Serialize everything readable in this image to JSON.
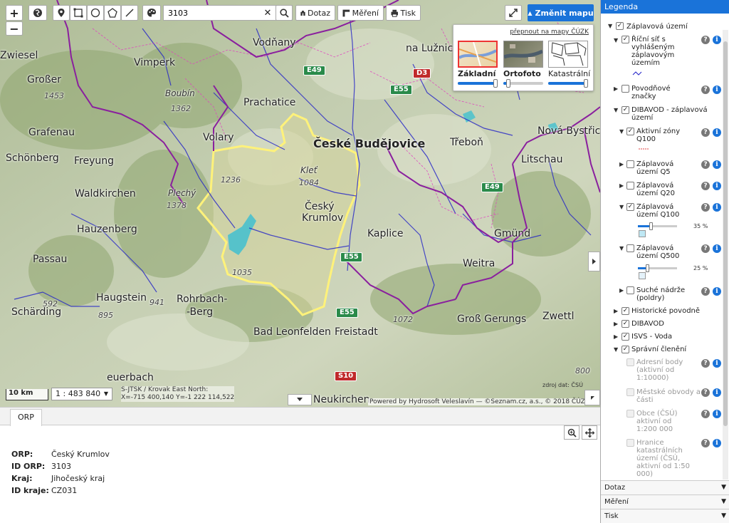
{
  "toolbar": {
    "search_value": "3103",
    "dotaz_label": "Dotaz",
    "mereni_label": "Měření",
    "tisk_label": "Tisk",
    "zmenit_label": "Změnit mapu"
  },
  "map_switch": {
    "link": "přepnout na mapy ČÚZK",
    "options": [
      {
        "label": "Základní",
        "opacity": 1.0,
        "selected": true
      },
      {
        "label": "Ortofoto",
        "opacity": 0.12,
        "selected": false
      },
      {
        "label": "Katastrální",
        "opacity": 1.0,
        "selected": false
      }
    ]
  },
  "map": {
    "labels": {
      "zwiesel": "Zwiesel",
      "grosser_arber": "Großer\nArber",
      "vimperk": "Vimperk",
      "vodnany": "Vodňany",
      "nahory": "na Lužnicí",
      "boubin": "Boubín",
      "prachatice": "Prachatice",
      "volary": "Volary",
      "grafenau": "Grafenau",
      "ceske_budejovice": "České Budějovice",
      "trebon": "Třeboň",
      "nove_bystrice": "Nová Bystřice",
      "schonberg": "Schönberg",
      "freyung": "Freyung",
      "klet": "Kleť",
      "cesky_krumlov": "Český\nKrumlov",
      "litschau": "Litschau",
      "waldkirchen": "Waldkirchen",
      "plechy": "Plechý",
      "hauzenberg": "Hauzenberg",
      "kaplice": "Kaplice",
      "gmund": "Gmünd",
      "passau": "Passau",
      "weitra": "Weitra",
      "haugstein": "Haugstein",
      "rohrbach": "Rohrbach-\n-Berg",
      "scharding": "Schärding",
      "bad_leonfelden": "Bad Leonfelden",
      "freistadt": "Freistadt",
      "gross_gerungs": "Groß Gerungs",
      "zwettl": "Zwettl",
      "euerbach": "euerbach",
      "kirchen": "Neukirchen"
    },
    "elevations": [
      "1453",
      "1362",
      "1236",
      "1084",
      "1378",
      "1035",
      "592",
      "895",
      "941",
      "1072",
      "800"
    ],
    "roads": [
      "D3",
      "E55",
      "E49",
      "E49",
      "E55",
      "E55",
      "S10"
    ],
    "scale_bar": "10 km",
    "scale_select": "1 : 483 840",
    "coord_system": "S-JTSK / Krovak East North:",
    "coords": "X=-715 400,140 Y=-1 222 114,522",
    "copyright": "Powered by Hydrosoft Veleslavín — ©Seznam.cz, a.s., © 2018 ČÚZK",
    "source": "zdroj dat: ČSÚ"
  },
  "bottom_panel": {
    "tab": "ORP",
    "rows": [
      {
        "key": "ORP:",
        "value": "Český Krumlov"
      },
      {
        "key": "ID ORP:",
        "value": "3103"
      },
      {
        "key": "Kraj:",
        "value": "Jihočeský kraj"
      },
      {
        "key": "ID kraje:",
        "value": "CZ031"
      }
    ]
  },
  "legend": {
    "title": "Legenda",
    "items": {
      "zaplavova": "Záplavová území",
      "ricni": "Říční síť s vyhlášeným záplavovým územím",
      "povodnove": "Povodňové značky",
      "dibavod_zap": "DIBAVOD - záplavová území",
      "aktivni": "Aktivní zóny Q100",
      "q5": "Záplavová území Q5",
      "q20": "Záplavová území Q20",
      "q100": "Záplavová území Q100",
      "q100_pct": "35 %",
      "q500": "Záplavová území Q500",
      "q500_pct": "25 %",
      "suche": "Suché nádrže (poldry)",
      "historicke": "Historické povodně",
      "dibavod": "DIBAVOD",
      "isvs": "ISVS - Voda",
      "spravni": "Správní členění",
      "adresni": "Adresní body (aktivní od 1:10000)",
      "mestske": "Městské obvody a části",
      "obce": "Obce (ČSÚ) aktivní od 1:200 000",
      "hranice": "Hranice katastrálních území (ČSÚ, aktivní od 1:50 000)"
    },
    "opacity": {
      "q100": 0.35,
      "q500": 0.25
    },
    "accordions": [
      "Dotaz",
      "Měření",
      "Tisk"
    ]
  },
  "colors": {
    "accent": "#1a73d9",
    "highlight_outline": "#fff27a",
    "district_border": "#8a1f9e",
    "rivers": "#2222c8",
    "flood_zone": "#41c0d0"
  }
}
